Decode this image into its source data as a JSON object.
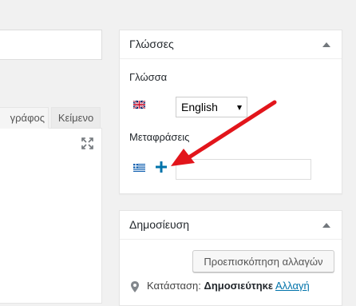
{
  "editor": {
    "tabs": [
      {
        "label": "γράφος"
      },
      {
        "label": "Κείμενο"
      }
    ]
  },
  "languages_box": {
    "title": "Γλώσσες",
    "language_label": "Γλώσσα",
    "selected_language": "English",
    "translations_label": "Μεταφράσεις",
    "translation_value": ""
  },
  "publish_box": {
    "title": "Δημοσίευση",
    "preview_button": "Προεπισκόπηση αλλαγών",
    "status_label": "Κατάσταση:",
    "status_value": "Δημοσιεύτηκε",
    "status_change_link": "Αλλαγή"
  },
  "colors": {
    "background": "#f1f1f1",
    "accent_blue": "#0073aa",
    "arrow_red": "#e2151b"
  }
}
